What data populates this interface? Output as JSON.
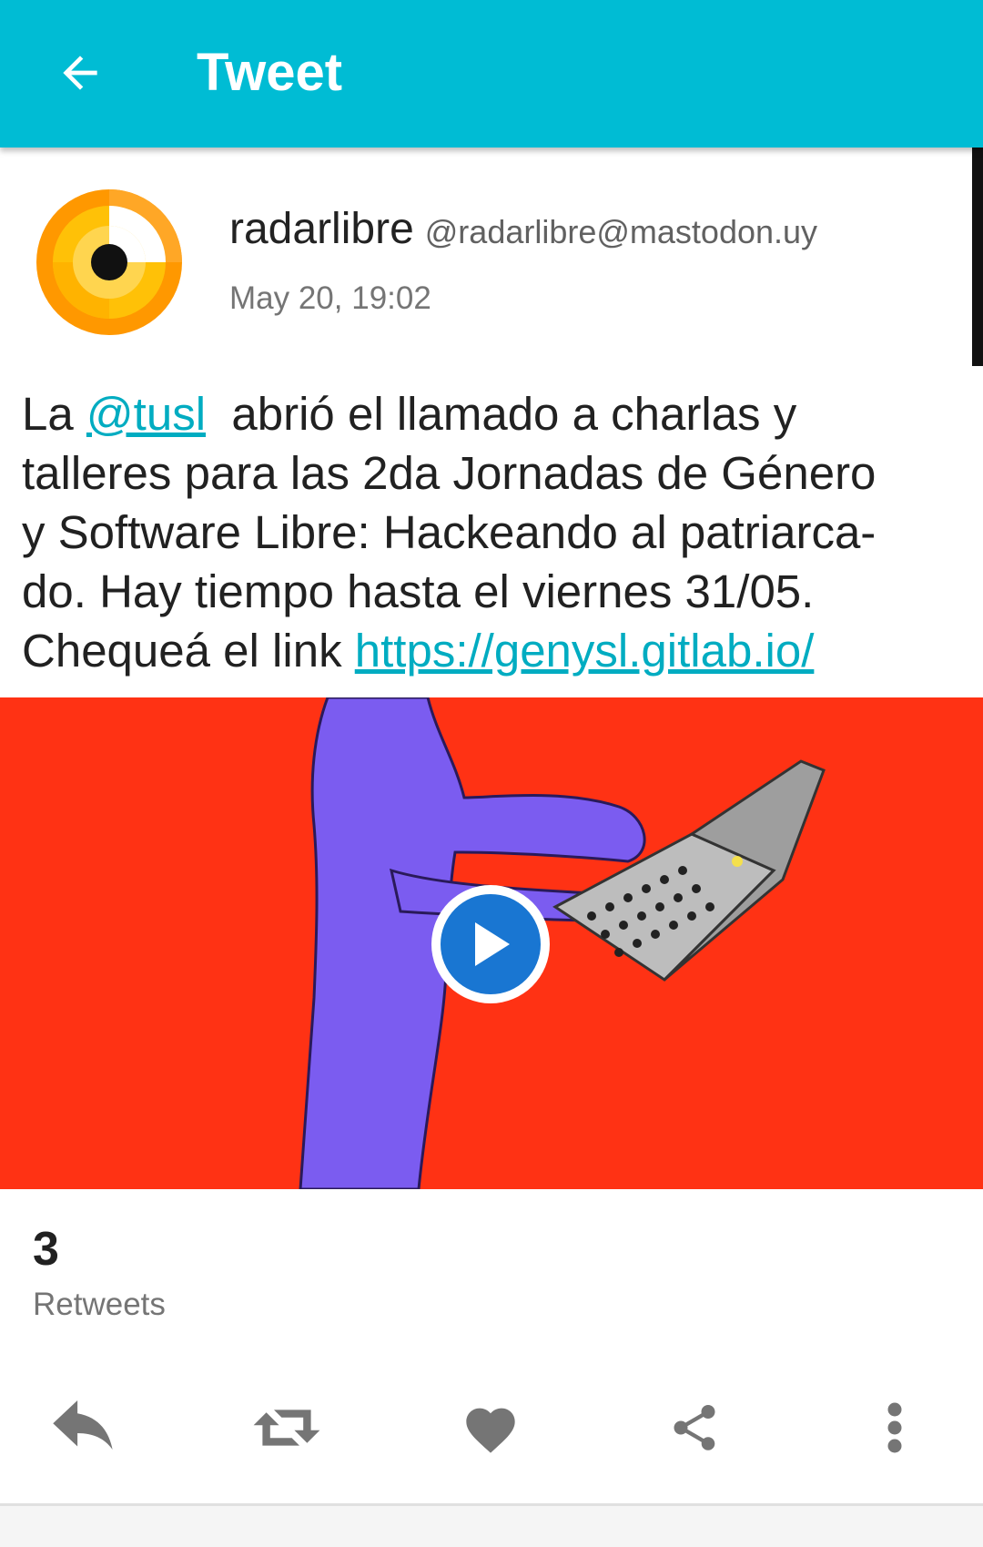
{
  "appbar": {
    "title": "Tweet",
    "back_icon": "arrow-left-icon",
    "background": "#00BCD4"
  },
  "status": {
    "display_name": "radarlibre",
    "username": "@radarlibre@mastodon.uy",
    "timestamp": "May 20, 19:02",
    "content": {
      "prefix": "La ",
      "mention": "@tusl",
      "line1_rest": "  abrió el llamado a charlas y",
      "line2": "talleres para las 2da Jornadas de Género",
      "line3": "y Software Libre: Hackeando al patriarca-",
      "line4": "do. Hay tiempo hasta el viernes 31/05.",
      "line5_prefix": "Chequeá el link ",
      "link": "https://genysl.gitlab.io/"
    },
    "media": {
      "type": "video",
      "play_icon": "play-icon",
      "background": "#FF3214"
    }
  },
  "counts": {
    "retweets_count": "3",
    "retweets_label": "Retweets"
  },
  "actions": [
    {
      "name": "reply",
      "icon": "reply-icon"
    },
    {
      "name": "retweet",
      "icon": "retweet-icon"
    },
    {
      "name": "favourite",
      "icon": "heart-icon"
    },
    {
      "name": "share",
      "icon": "share-icon"
    },
    {
      "name": "more",
      "icon": "more-vertical-icon"
    }
  ],
  "colors": {
    "accent": "#00BCD4",
    "link": "#00ACC1",
    "icon_gray": "#757575",
    "play_blue": "#1976D2"
  }
}
